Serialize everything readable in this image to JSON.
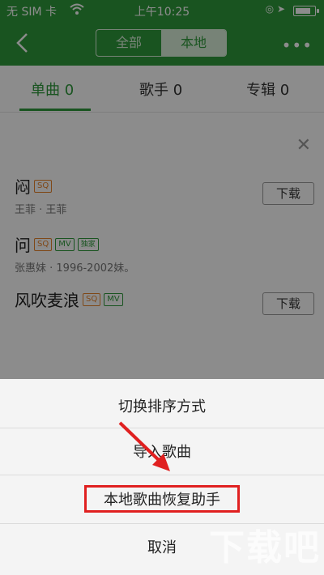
{
  "status_bar": {
    "carrier": "无 SIM 卡",
    "time": "上午10:25",
    "icons": [
      "wifi-icon",
      "location-icon",
      "battery-icon"
    ]
  },
  "navbar": {
    "back_icon": "chevron-left-icon",
    "segments": [
      "全部",
      "本地"
    ],
    "active_segment": "本地",
    "more_icon": "more-dots-icon"
  },
  "tabs": [
    {
      "label": "单曲 0",
      "active": true
    },
    {
      "label": "歌手 0",
      "active": false
    },
    {
      "label": "专辑 0",
      "active": false
    }
  ],
  "songs": [
    {
      "title": "闷",
      "tags": [
        "SQ"
      ],
      "subtitle": "王菲 · 王菲",
      "action": "下载"
    },
    {
      "title": "问",
      "tags": [
        "SQ",
        "MV",
        "独家"
      ],
      "subtitle": "张惠妹 · 1996-2002妹。",
      "action": ""
    },
    {
      "title": "风吹麦浪",
      "tags": [
        "SQ",
        "MV"
      ],
      "subtitle": "",
      "action": "下载"
    }
  ],
  "action_sheet": {
    "items": [
      "切换排序方式",
      "导入歌曲",
      "本地歌曲恢复助手",
      "取消"
    ],
    "highlighted_index": 2
  },
  "watermark": "下载吧",
  "colors": {
    "brand_green": "#2f9a3b",
    "highlight_red": "#e02020"
  }
}
